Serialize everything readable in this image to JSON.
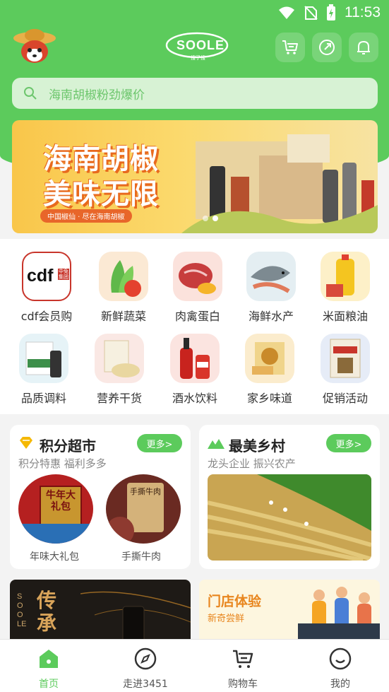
{
  "status_bar": {
    "time": "11:53"
  },
  "header": {
    "logo_text": "SOOLE",
    "logo_sub": "搜了搜",
    "search_placeholder": "海南胡椒粉劲爆价"
  },
  "banner": {
    "title_line1": "海南胡椒",
    "title_line2": "美味无限",
    "tag": "中国椒仙 · 尽在海南胡椒",
    "slide_count": 2,
    "active_slide": 1
  },
  "categories": [
    {
      "label": "cdf会员购",
      "icon": "cdf-logo-icon"
    },
    {
      "label": "新鲜蔬菜",
      "icon": "vegetables-icon"
    },
    {
      "label": "肉禽蛋白",
      "icon": "meat-icon"
    },
    {
      "label": "海鲜水产",
      "icon": "seafood-icon"
    },
    {
      "label": "米面粮油",
      "icon": "grain-oil-icon"
    },
    {
      "label": "品质调料",
      "icon": "seasoning-icon"
    },
    {
      "label": "营养干货",
      "icon": "dry-goods-icon"
    },
    {
      "label": "酒水饮料",
      "icon": "drinks-icon"
    },
    {
      "label": "家乡味道",
      "icon": "hometown-food-icon"
    },
    {
      "label": "促销活动",
      "icon": "promotion-icon"
    }
  ],
  "cdf_logo_text": "cdf",
  "cdf_badge_text": "中免集团",
  "points_market": {
    "title": "积分超市",
    "subtitle": "积分特惠 福利多多",
    "more": "更多>",
    "items": [
      {
        "label": "年味大礼包",
        "image_text": "牛年大礼包"
      },
      {
        "label": "手撕牛肉",
        "image_text": "手撕牛肉"
      }
    ]
  },
  "village": {
    "title": "最美乡村",
    "subtitle": "龙头企业  振兴农产",
    "more": "更多>"
  },
  "bottom_left_card": {
    "title": "传承",
    "side_text": "SOOLE"
  },
  "store_card": {
    "title": "门店体验",
    "subtitle": "新奇尝鲜"
  },
  "tabbar": {
    "tabs": [
      {
        "label": "首页",
        "icon": "home-icon",
        "active": true
      },
      {
        "label": "走进3451",
        "icon": "compass-icon",
        "active": false
      },
      {
        "label": "购物车",
        "icon": "cart-icon",
        "active": false
      },
      {
        "label": "我的",
        "icon": "smiley-icon",
        "active": false
      }
    ]
  },
  "colors": {
    "brand_green": "#5ccb5c",
    "search_bg": "#d7f2d4",
    "banner_orange": "#e8662a"
  }
}
